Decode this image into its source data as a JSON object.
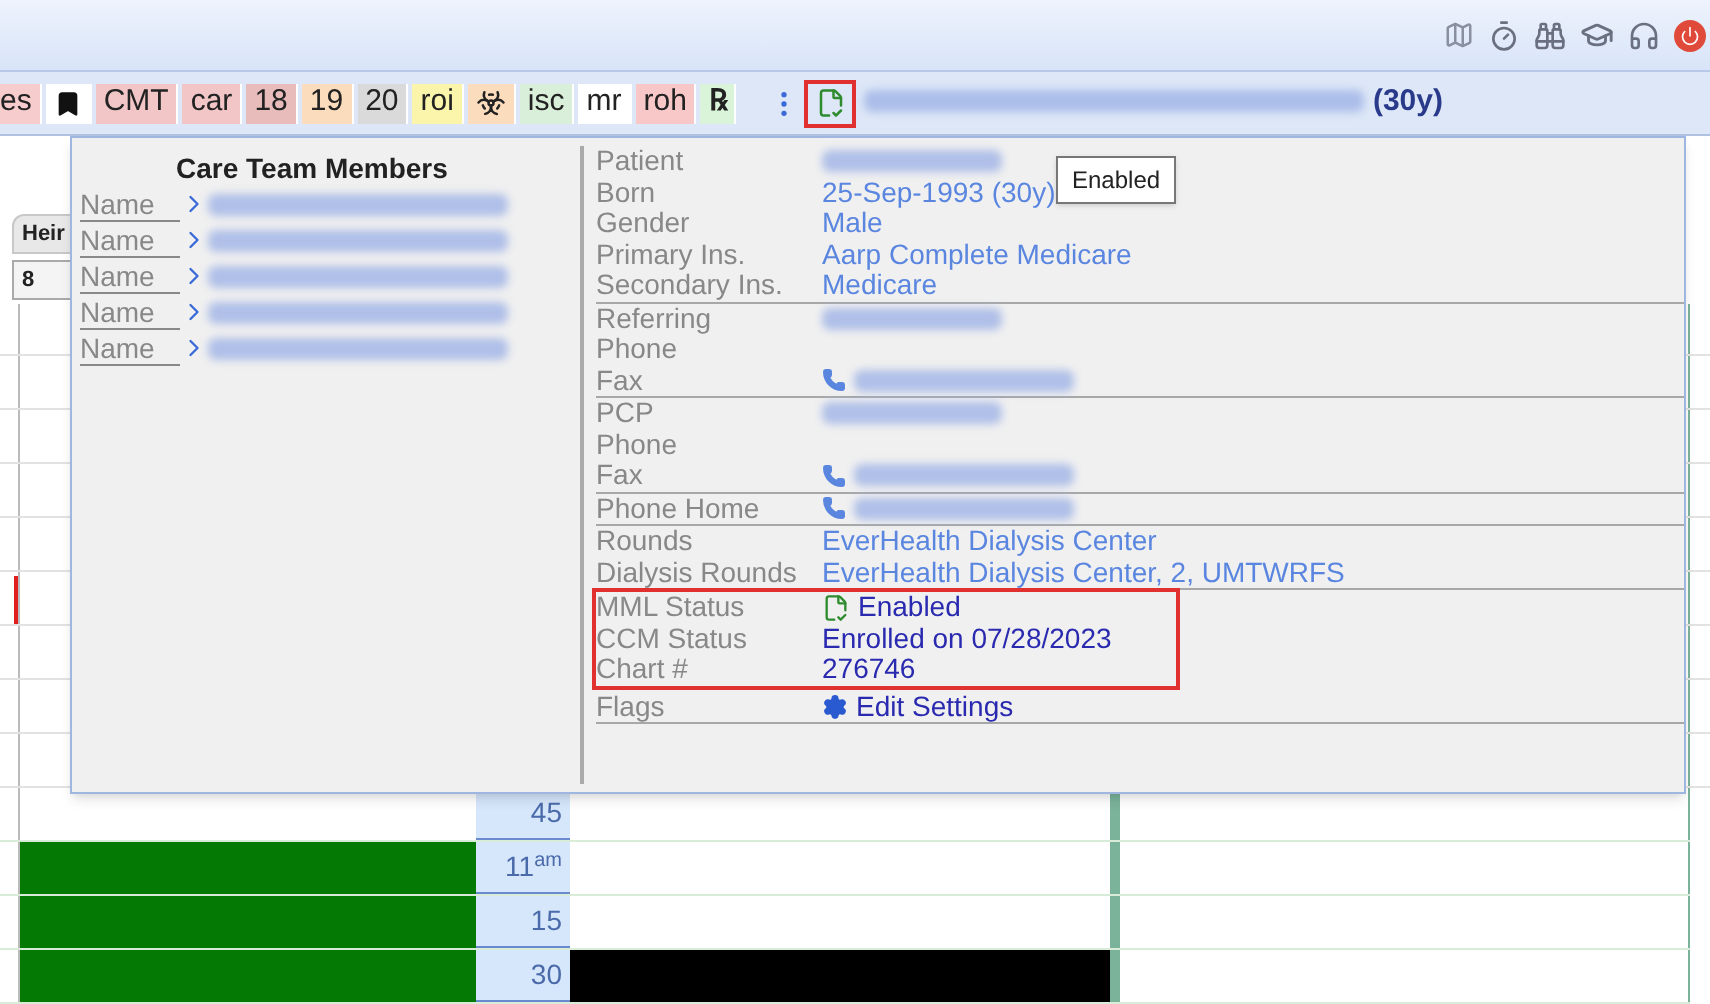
{
  "toolbar": {
    "tags": [
      {
        "kind": "text",
        "label": "es",
        "color": "#f7cccc"
      },
      {
        "kind": "bookmark",
        "color": "#ffffff"
      },
      {
        "kind": "text",
        "label": "CMT",
        "color": "#f2c6c6"
      },
      {
        "kind": "text",
        "label": "car",
        "color": "#f2c6c6"
      },
      {
        "kind": "text",
        "label": "18",
        "color": "#e9bcbc"
      },
      {
        "kind": "text",
        "label": "19",
        "color": "#fbdcbc"
      },
      {
        "kind": "text",
        "label": "20",
        "color": "#dadada"
      },
      {
        "kind": "text",
        "label": "roi",
        "color": "#fbf4ab"
      },
      {
        "kind": "biohazard",
        "color": "#fbdcbc"
      },
      {
        "kind": "text",
        "label": "isc",
        "color": "#d9efd9"
      },
      {
        "kind": "text",
        "label": "mr",
        "color": "#ffffff"
      },
      {
        "kind": "text",
        "label": "roh",
        "color": "#f8c8c8"
      },
      {
        "kind": "glyph",
        "label": "℞",
        "color": "#d9f4d9"
      }
    ],
    "patient_age": "(30y)"
  },
  "tooltip": "Enabled",
  "calendar": {
    "tab": "Heir",
    "cell": "8",
    "rows": [
      {
        "time": "45",
        "left_booked": false,
        "middle_booked": false
      },
      {
        "time": "11",
        "time_suffix": "am",
        "left_booked": true,
        "middle_booked": false
      },
      {
        "time": "15",
        "left_booked": true,
        "middle_booked": false
      },
      {
        "time": "30",
        "left_booked": true,
        "middle_booked": true
      }
    ]
  },
  "care_team": {
    "title": "Care Team Members",
    "members": [
      {
        "label": "Name"
      },
      {
        "label": "Name"
      },
      {
        "label": "Name"
      },
      {
        "label": "Name"
      },
      {
        "label": "Name"
      }
    ]
  },
  "patient_details": {
    "groups": [
      {
        "highlighted": false,
        "rows": [
          {
            "label": "Patient",
            "kind": "hidden"
          },
          {
            "label": "Born",
            "kind": "text",
            "value": "25-Sep-1993 (30y)"
          },
          {
            "label": "Gender",
            "kind": "text",
            "value": "Male"
          },
          {
            "label": "Primary Ins.",
            "kind": "text",
            "value": "Aarp Complete Medicare"
          },
          {
            "label": "Secondary Ins.",
            "kind": "text",
            "value": "Medicare"
          }
        ]
      },
      {
        "highlighted": false,
        "rows": [
          {
            "label": "Referring",
            "kind": "hidden"
          },
          {
            "label": "Phone",
            "kind": "empty"
          },
          {
            "label": "Fax",
            "kind": "phone"
          }
        ]
      },
      {
        "highlighted": false,
        "rows": [
          {
            "label": "PCP",
            "kind": "hidden"
          },
          {
            "label": "Phone",
            "kind": "empty"
          },
          {
            "label": "Fax",
            "kind": "phone"
          }
        ]
      },
      {
        "highlighted": false,
        "rows": [
          {
            "label": "Phone Home",
            "kind": "phone"
          }
        ]
      },
      {
        "highlighted": false,
        "rows": [
          {
            "label": "Rounds",
            "kind": "text",
            "value": "EverHealth Dialysis Center"
          },
          {
            "label": "Dialysis Rounds",
            "kind": "text",
            "value": "EverHealth Dialysis Center, 2, UMTWRFS"
          }
        ]
      },
      {
        "highlighted": true,
        "rows": [
          {
            "label": "MML Status",
            "kind": "status",
            "value": "Enabled"
          },
          {
            "label": "CCM Status",
            "kind": "strong",
            "value": "Enrolled on 07/28/2023"
          },
          {
            "label": "Chart #",
            "kind": "strong",
            "value": "276746"
          }
        ]
      },
      {
        "highlighted": false,
        "rows": [
          {
            "label": "Flags",
            "kind": "settings",
            "value": "Edit Settings"
          }
        ]
      }
    ]
  }
}
